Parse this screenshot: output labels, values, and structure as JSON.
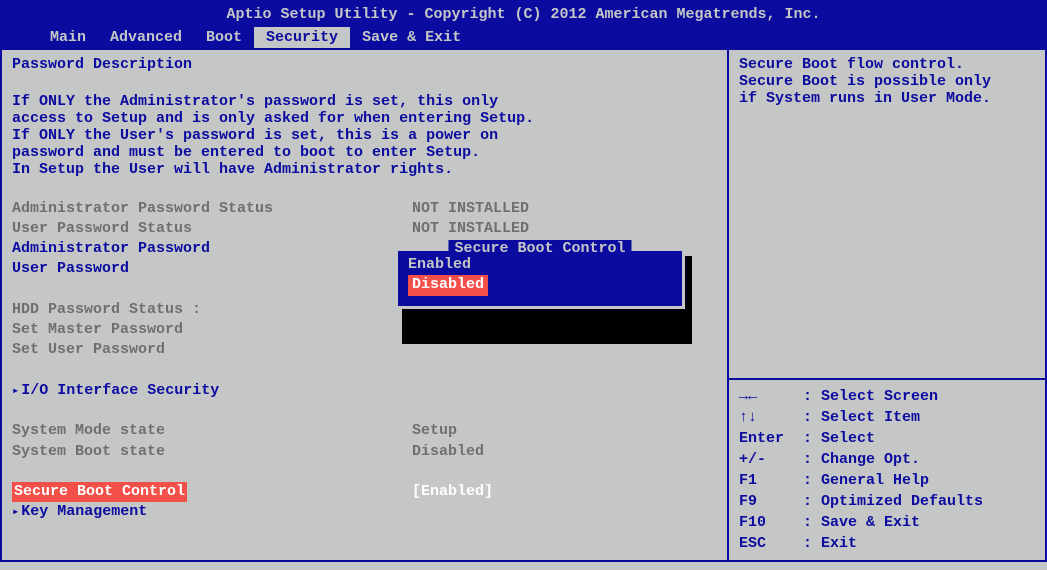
{
  "header": {
    "title": "Aptio Setup Utility - Copyright (C) 2012 American Megatrends, Inc."
  },
  "tabs": [
    "Main",
    "Advanced",
    "Boot",
    "Security",
    "Save & Exit"
  ],
  "active_tab": "Security",
  "desc": {
    "heading": "Password Description",
    "p1": "If ONLY the Administrator's password is set, this only",
    "p2": "access to Setup and is only asked for when entering Setup.",
    "p3": "If ONLY the User's password is set, this is a power on",
    "p4": "password and must be entered to boot to enter Setup.",
    "p5": "In Setup the User will have Administrator rights."
  },
  "items": {
    "admin_status_label": "Administrator Password Status",
    "admin_status_value": "NOT INSTALLED",
    "user_status_label": "User Password Status",
    "user_status_value": "NOT INSTALLED",
    "admin_pw": "Administrator Password",
    "user_pw": "User Password",
    "hdd_status": "HDD Password Status  :",
    "set_master": "Set Master Password",
    "set_user": "Set User Password",
    "io_sec": "I/O Interface Security",
    "sys_mode_label": "System Mode state",
    "sys_mode_value": "Setup",
    "sys_boot_label": "System Boot state",
    "sys_boot_value": "Disabled",
    "secure_boot_label": "Secure Boot Control",
    "secure_boot_value": "[Enabled]",
    "key_mgmt": "Key Management"
  },
  "popup": {
    "title": "Secure Boot Control",
    "options": [
      "Enabled",
      "Disabled"
    ],
    "selected": "Disabled"
  },
  "help": {
    "l1": "Secure Boot flow control.",
    "l2": "Secure Boot is possible only",
    "l3": "if System runs in User Mode."
  },
  "keys": {
    "screen": {
      "k": "→←",
      "t": ": Select Screen"
    },
    "item": {
      "k": "↑↓",
      "t": ": Select Item"
    },
    "enter": {
      "k": "Enter",
      "t": ": Select"
    },
    "change": {
      "k": "+/-",
      "t": ": Change Opt."
    },
    "help": {
      "k": "F1",
      "t": ": General Help"
    },
    "defaults": {
      "k": "F9",
      "t": ": Optimized Defaults"
    },
    "save": {
      "k": "F10",
      "t": ": Save & Exit"
    },
    "exit": {
      "k": "ESC",
      "t": ": Exit"
    }
  }
}
